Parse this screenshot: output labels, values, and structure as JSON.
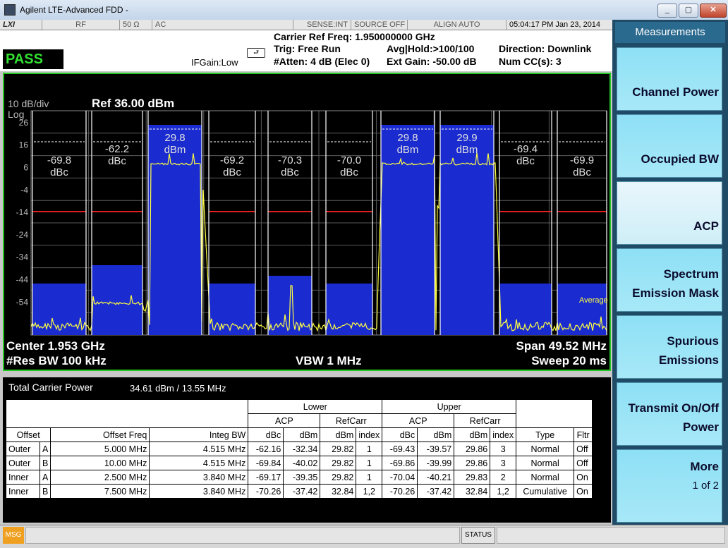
{
  "window": {
    "title": "Agilent LTE-Advanced FDD -",
    "min": "_",
    "max": "▢",
    "close": "✕"
  },
  "status_row": {
    "lxi": "LXI",
    "rf": "RF",
    "impedance": "50 Ω",
    "coupling": "AC",
    "sense": "SENSE:INT",
    "source": "SOURCE OFF",
    "align": "ALIGN AUTO",
    "datetime": "05:04:17 PM Jan 23, 2014"
  },
  "info": {
    "pass": "PASS",
    "ifgain": "IFGain:Low",
    "carrier_ref_freq": "Carrier Ref Freq: 1.950000000 GHz",
    "trig": "Trig: Free Run",
    "atten": "#Atten: 4 dB (Elec 0)",
    "avg_hold": "Avg|Hold:>100/100",
    "ext_gain": "Ext Gain: -50.00 dB",
    "direction": "Direction: Downlink",
    "num_cc": "Num CC(s): 3"
  },
  "graph": {
    "scale": "10 dB/div",
    "log": "Log",
    "ref": "Ref 36.00 dBm",
    "yticks": [
      "26",
      "16",
      "6",
      "-4",
      "-14",
      "-24",
      "-34",
      "-44",
      "-54"
    ],
    "average_label": "Average",
    "center": "Center  1.953 GHz",
    "res_bw": "#Res BW  100 kHz",
    "vbw": "VBW  1 MHz",
    "span": "Span 49.52 MHz",
    "sweep": "Sweep  20 ms",
    "segments": [
      {
        "v": "-69.8",
        "u": "dBc"
      },
      {
        "v": "-62.2",
        "u": "dBc"
      },
      {
        "v": "29.8",
        "u": "dBm"
      },
      {
        "v": "-69.2",
        "u": "dBc"
      },
      {
        "v": "-70.3",
        "u": "dBc"
      },
      {
        "v": "-70.0",
        "u": "dBc"
      },
      {
        "v": "29.8",
        "u": "dBm"
      },
      {
        "v": "29.9",
        "u": "dBm"
      },
      {
        "v": "-69.4",
        "u": "dBc"
      },
      {
        "v": "-69.9",
        "u": "dBc"
      }
    ]
  },
  "table": {
    "total_carrier_power_label": "Total Carrier Power",
    "total_carrier_power_value": "34.61 dBm / 13.55 MHz",
    "group_lower": "Lower",
    "group_upper": "Upper",
    "sub_acp": "ACP",
    "sub_refcarr": "RefCarr",
    "headers": [
      "Offset",
      "Offset Freq",
      "Integ BW",
      "dBc",
      "dBm",
      "dBm",
      "index",
      "dBc",
      "dBm",
      "dBm",
      "index",
      "Type",
      "Fltr"
    ],
    "rows": [
      [
        "Outer",
        "A",
        "5.000 MHz",
        "4.515 MHz",
        "-62.16",
        "-32.34",
        "29.82",
        "1",
        "-69.43",
        "-39.57",
        "29.86",
        "3",
        "Normal",
        "Off"
      ],
      [
        "Outer",
        "B",
        "10.00 MHz",
        "4.515 MHz",
        "-69.84",
        "-40.02",
        "29.82",
        "1",
        "-69.86",
        "-39.99",
        "29.86",
        "3",
        "Normal",
        "Off"
      ],
      [
        "Inner",
        "A",
        "2.500 MHz",
        "3.840 MHz",
        "-69.17",
        "-39.35",
        "29.82",
        "1",
        "-70.04",
        "-40.21",
        "29.83",
        "2",
        "Normal",
        "On"
      ],
      [
        "Inner",
        "B",
        "7.500 MHz",
        "3.840 MHz",
        "-70.26",
        "-37.42",
        "32.84",
        "1,2",
        "-70.26",
        "-37.42",
        "32.84",
        "1,2",
        "Cumulative",
        "On"
      ]
    ]
  },
  "menu": {
    "title": "Measurements",
    "items": [
      {
        "l1": "",
        "l2": "Channel Power"
      },
      {
        "l1": "",
        "l2": "Occupied BW"
      },
      {
        "l1": "",
        "l2": "ACP"
      },
      {
        "l1": "Spectrum",
        "l2": "Emission Mask"
      },
      {
        "l1": "Spurious",
        "l2": "Emissions"
      },
      {
        "l1": "Transmit On/Off",
        "l2": "Power"
      },
      {
        "l1": "More",
        "l2": "1 of 2"
      }
    ]
  },
  "bottom": {
    "msg": "MSG",
    "status": "STATUS"
  },
  "colors": {
    "pass_green": "#31e031",
    "frame_green": "#23c823",
    "trace_yellow": "#ffff40",
    "limit_red": "#e02020",
    "bar_blue": "#1a2bd0",
    "menu_cyan": "#8ee0f5"
  }
}
